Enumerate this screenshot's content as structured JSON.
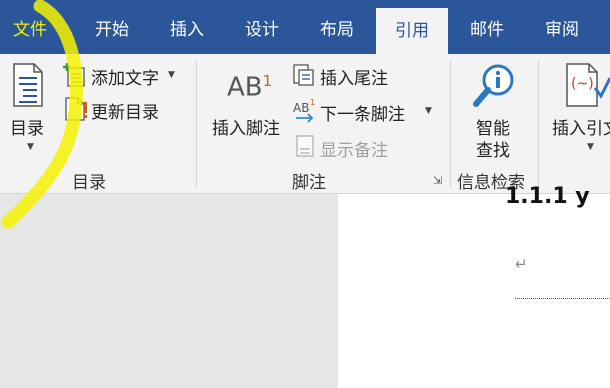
{
  "tabs": [
    {
      "label": "文件"
    },
    {
      "label": "开始"
    },
    {
      "label": "插入"
    },
    {
      "label": "设计"
    },
    {
      "label": "布局"
    },
    {
      "label": "引用"
    },
    {
      "label": "邮件"
    },
    {
      "label": "审阅"
    }
  ],
  "active_tab": "引用",
  "groups": {
    "toc": {
      "label": "目录",
      "toc_button": "目录",
      "add_text": "添加文字",
      "update_toc": "更新目录"
    },
    "footnotes": {
      "label": "脚注",
      "insert_footnote": "插入脚注",
      "footnote_icon_text": "AB",
      "footnote_icon_sup": "1",
      "insert_endnote": "插入尾注",
      "next_footnote": "下一条脚注",
      "show_notes": "显示备注"
    },
    "research": {
      "label": "信息检索",
      "smart_lookup_line1": "智能",
      "smart_lookup_line2": "查找"
    },
    "citations": {
      "insert_citation": "插入引文"
    }
  },
  "document": {
    "heading": "1.1.1 y",
    "paragraph_mark": "↵"
  },
  "colors": {
    "tab_bar": "#2b579a",
    "ribbon": "#f3f3f3",
    "highlighter": "#f4f100"
  }
}
